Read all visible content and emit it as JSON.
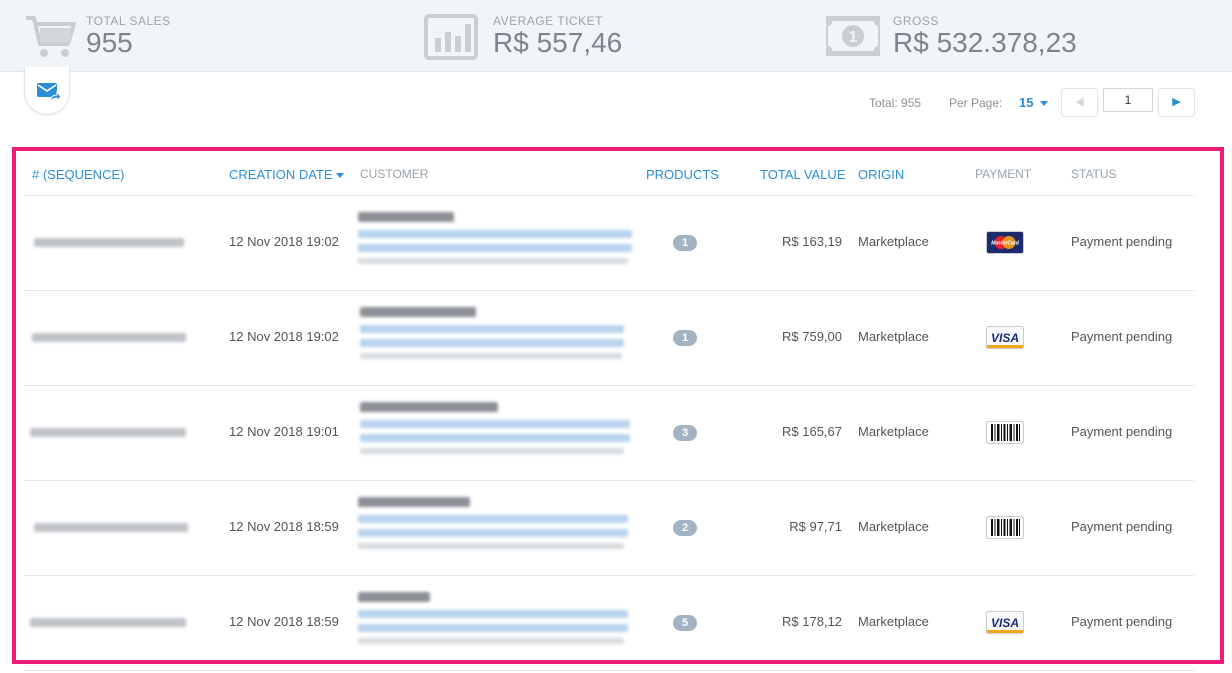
{
  "stats": {
    "total_sales": {
      "label": "TOTAL SALES",
      "value": "955",
      "icon": "cart-icon"
    },
    "average_ticket": {
      "label": "AVERAGE TICKET",
      "value": "R$ 557,46",
      "icon": "bar-chart-icon"
    },
    "gross": {
      "label": "GROSS",
      "value": "R$ 532.378,23",
      "icon": "banknote-icon"
    }
  },
  "toolbar": {
    "email_icon": "email-forward-icon"
  },
  "pagination": {
    "total_text": "Total: 955",
    "per_page_label": "Per Page:",
    "per_page_value": "15",
    "current_page": "1"
  },
  "table": {
    "headers": {
      "sequence": "# (SEQUENCE)",
      "creation_date": "CREATION DATE",
      "customer": "CUSTOMER",
      "products": "PRODUCTS",
      "total_value": "TOTAL VALUE",
      "origin": "ORIGIN",
      "payment": "PAYMENT",
      "status": "STATUS"
    },
    "rows": [
      {
        "date": "12 Nov 2018 19:02",
        "products": "1",
        "total": "R$ 163,19",
        "origin": "Marketplace",
        "payment": "mastercard",
        "status": "Payment pending"
      },
      {
        "date": "12 Nov 2018 19:02",
        "products": "1",
        "total": "R$ 759,00",
        "origin": "Marketplace",
        "payment": "visa",
        "status": "Payment pending"
      },
      {
        "date": "12 Nov 2018 19:01",
        "products": "3",
        "total": "R$ 165,67",
        "origin": "Marketplace",
        "payment": "boleto",
        "status": "Payment pending"
      },
      {
        "date": "12 Nov 2018 18:59",
        "products": "2",
        "total": "R$ 97,71",
        "origin": "Marketplace",
        "payment": "boleto",
        "status": "Payment pending"
      },
      {
        "date": "12 Nov 2018 18:59",
        "products": "5",
        "total": "R$ 178,12",
        "origin": "Marketplace",
        "payment": "visa",
        "status": "Payment pending"
      }
    ]
  },
  "colors": {
    "accent": "#2a8fd6",
    "highlight": "#ee1c7a",
    "badge": "#a3b3c2"
  }
}
